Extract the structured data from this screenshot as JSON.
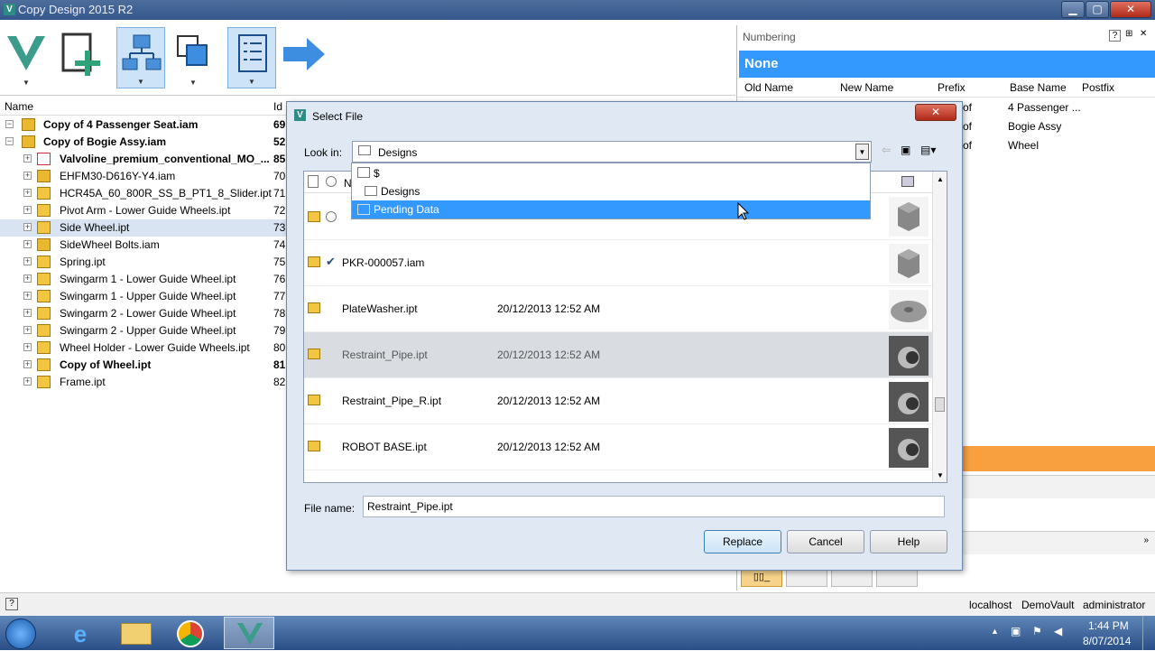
{
  "app": {
    "title": "Copy Design 2015 R2",
    "minimize": "▁",
    "maximize": "▢",
    "close": "✕"
  },
  "tree": {
    "col_name": "Name",
    "col_id": "Id",
    "items": [
      {
        "label": "Copy of 4 Passenger Seat.iam",
        "id": "69",
        "bold": true,
        "level": 0,
        "icon": "assembly-icon"
      },
      {
        "label": "Copy of Bogie Assy.iam",
        "id": "52",
        "bold": true,
        "level": 0,
        "icon": "assembly-icon"
      },
      {
        "label": "Valvoline_premium_conventional_MO_...",
        "id": "85",
        "bold": true,
        "level": 1,
        "icon": "pdf-icon"
      },
      {
        "label": "EHFM30-D616Y-Y4.iam",
        "id": "70",
        "bold": false,
        "level": 1,
        "icon": "assembly-icon"
      },
      {
        "label": "HCR45A_60_800R_SS_B_PT1_8_Slider.ipt",
        "id": "71",
        "bold": false,
        "level": 1,
        "icon": "part-icon"
      },
      {
        "label": "Pivot Arm - Lower Guide Wheels.ipt",
        "id": "72",
        "bold": false,
        "level": 1,
        "icon": "part-icon"
      },
      {
        "label": "Side Wheel.ipt",
        "id": "73",
        "bold": false,
        "level": 1,
        "icon": "part-icon"
      },
      {
        "label": "SideWheel Bolts.iam",
        "id": "74",
        "bold": false,
        "level": 1,
        "icon": "assembly-icon"
      },
      {
        "label": "Spring.ipt",
        "id": "75",
        "bold": false,
        "level": 1,
        "icon": "part-icon"
      },
      {
        "label": "Swingarm 1 - Lower Guide Wheel.ipt",
        "id": "76",
        "bold": false,
        "level": 1,
        "icon": "part-icon"
      },
      {
        "label": "Swingarm 1 - Upper Guide Wheel.ipt",
        "id": "77",
        "bold": false,
        "level": 1,
        "icon": "part-icon"
      },
      {
        "label": "Swingarm 2 - Lower Guide Wheel.ipt",
        "id": "78",
        "bold": false,
        "level": 1,
        "icon": "part-icon"
      },
      {
        "label": "Swingarm 2 - Upper Guide Wheel.ipt",
        "id": "79",
        "bold": false,
        "level": 1,
        "icon": "part-icon"
      },
      {
        "label": "Wheel Holder - Lower Guide Wheels.ipt",
        "id": "80",
        "bold": false,
        "level": 1,
        "icon": "part-icon"
      },
      {
        "label": "Copy of Wheel.ipt",
        "id": "81",
        "bold": true,
        "level": 1,
        "icon": "part-icon"
      },
      {
        "label": "Frame.ipt",
        "id": "82",
        "bold": false,
        "level": 1,
        "icon": "part-icon"
      }
    ]
  },
  "numbering": {
    "title": "Numbering",
    "scheme": "None",
    "help": "?",
    "cols": [
      "Old Name",
      "New Name",
      "Prefix",
      "Base Name",
      "Postfix"
    ],
    "rows": [
      {
        "prefix": "of",
        "base": "4 Passenger ..."
      },
      {
        "prefix": "of",
        "base": "Bogie Assy"
      },
      {
        "prefix": "of",
        "base": "Wheel"
      }
    ]
  },
  "dialog": {
    "title": "Select File",
    "lookin_label": "Look in:",
    "lookin_value": "Designs",
    "dropdown": [
      "$",
      "Designs",
      "Pending Data"
    ],
    "col_name": "N",
    "files": [
      {
        "name": "PKR-000057.iam",
        "date": ""
      },
      {
        "name": "PlateWasher.ipt",
        "date": "20/12/2013 12:52 AM"
      },
      {
        "name": "Restraint_Pipe.ipt",
        "date": "20/12/2013 12:52 AM"
      },
      {
        "name": "Restraint_Pipe_R.ipt",
        "date": "20/12/2013 12:52 AM"
      },
      {
        "name": "ROBOT BASE.ipt",
        "date": "20/12/2013 12:52 AM"
      }
    ],
    "filename_label": "File name:",
    "filename_value": "Restraint_Pipe.ipt",
    "replace": "Replace",
    "cancel": "Cancel",
    "help": "Help",
    "close": "✕"
  },
  "status": {
    "help": "?",
    "server": "localhost",
    "vault": "DemoVault",
    "user": "administrator"
  },
  "taskbar": {
    "time": "1:44 PM",
    "date": "8/07/2014"
  },
  "colors": {
    "accent": "#3399ff",
    "orange": "#f8a040",
    "title": "#34578c"
  }
}
